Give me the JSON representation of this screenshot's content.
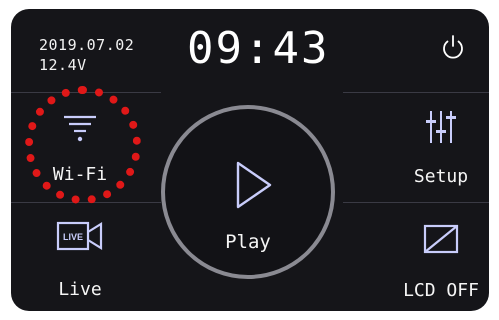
{
  "status": {
    "date": "2019.07.02",
    "voltage": "12.4V",
    "time": "09:43"
  },
  "tiles": {
    "wifi": {
      "label": "Wi-Fi",
      "icon": "wifi-icon"
    },
    "setup": {
      "label": "Setup",
      "icon": "sliders-icon"
    },
    "live": {
      "label": "Live",
      "icon": "live-camera-icon"
    },
    "lcd_off": {
      "label": "LCD OFF",
      "icon": "lcd-off-icon"
    },
    "play": {
      "label": "Play",
      "icon": "play-icon"
    }
  },
  "power_icon": "power-icon",
  "colors": {
    "background": "#151519",
    "accent": "#c9cdfb",
    "highlight": "#e01818"
  }
}
